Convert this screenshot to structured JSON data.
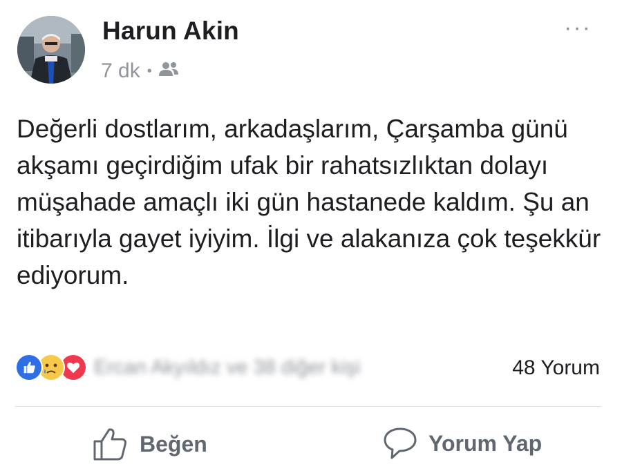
{
  "post": {
    "author": "Harun Akin",
    "time": "7 dk",
    "separator": "•",
    "audience_icon": "friends-icon",
    "more_label": "···",
    "text": "Değerli dostlarım, arkadaşlarım, Çarşamba günü akşamı geçirdiğim ufak bir rahatsızlıktan dolayı müşahade amaçlı iki gün hastanede kaldım. Şu an itibarıyla gayet iyiyim. İlgi ve alakanıza çok teşekkür ediyorum."
  },
  "reactions": {
    "icons": [
      "like-icon",
      "sad-icon",
      "love-icon"
    ],
    "summary": "Ercan Akyıldız ve 38 diğer kişi",
    "comment_count": "48 Yorum"
  },
  "actions": {
    "like_label": "Beğen",
    "comment_label": "Yorum Yap"
  },
  "colors": {
    "like_blue": "#2f6fe6",
    "love_red": "#f0394f",
    "sad_yellow": "#f6c94a",
    "meta_gray": "#90949c",
    "action_gray": "#606770"
  }
}
